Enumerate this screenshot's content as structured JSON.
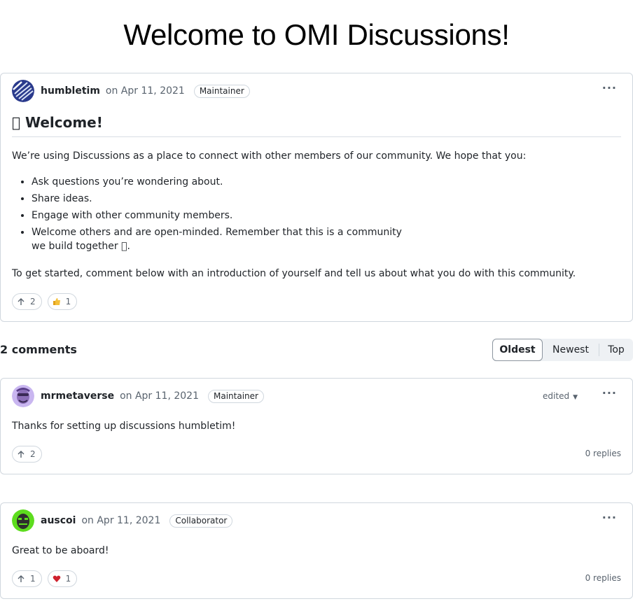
{
  "page": {
    "title": "Welcome to OMI Discussions!"
  },
  "post": {
    "author": "humbletim",
    "date": "on Apr 11, 2021",
    "role": "Maintainer",
    "more_icon": "kebab-horizontal-icon",
    "title": "\u0000 Welcome!",
    "intro": "We’re using Discussions as a place to connect with other members of our community. We hope that you:",
    "bullets": [
      "Ask questions you’re wondering about.",
      "Share ideas.",
      "Engage with other community members.",
      "Welcome others and are open-minded. Remember that this is a community we build together \u0000."
    ],
    "outro": "To get started, comment below with an introduction of yourself and tell us about what you do with this community.",
    "reactions": [
      {
        "icon": "arrow-up-icon",
        "count": "2"
      },
      {
        "icon": "thumbs-up-icon",
        "count": "1"
      }
    ]
  },
  "comments_header": {
    "count_label": "2 comments",
    "sort": {
      "oldest": "Oldest",
      "newest": "Newest",
      "top": "Top",
      "active": "Oldest"
    }
  },
  "comments": [
    {
      "author": "mrmetaverse",
      "date": "on Apr 11, 2021",
      "role": "Maintainer",
      "edited": "edited",
      "text": "Thanks for setting up discussions humbletim!",
      "upvotes": "2",
      "replies": "0 replies"
    },
    {
      "author": "auscoi",
      "date": "on Apr 11, 2021",
      "role": "Collaborator",
      "text": "Great to be aboard!",
      "upvotes": "1",
      "heart": "1",
      "replies": "0 replies"
    }
  ],
  "colors": {
    "border": "#d0d7de",
    "muted": "#59636e",
    "heart": "#cf222e",
    "thumb": "#e3a21a"
  }
}
